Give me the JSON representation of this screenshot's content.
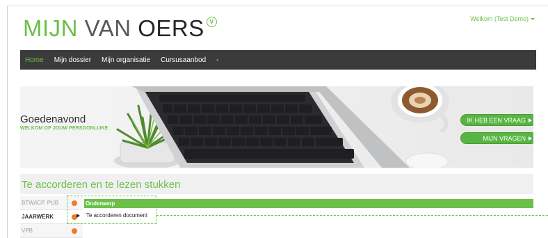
{
  "header": {
    "logo": {
      "part1": "MIJN ",
      "part2": "VAN ",
      "part3": "OERS",
      "mark": "V"
    },
    "welcome": "Welkom (Test Demo)"
  },
  "nav": {
    "items": [
      {
        "label": "Home",
        "active": true
      },
      {
        "label": "Mijn dossier",
        "active": false
      },
      {
        "label": "Mijn organisatie",
        "active": false
      },
      {
        "label": "Cursusaanbod",
        "active": false
      },
      {
        "label": "-",
        "active": false
      }
    ]
  },
  "hero": {
    "greeting": "Goedenavond",
    "subtitle": "WELKOM OP JOUW PERSOONLIJKE",
    "buttons": [
      {
        "label": "IK HEB EEN VRAAG"
      },
      {
        "label": "MIJN VRAGEN"
      }
    ],
    "colors": {
      "accent": "#6cc04a",
      "button": "#59b543"
    }
  },
  "section": {
    "title": "Te accorderen en te lezen stukken",
    "tabs": [
      {
        "label": "BTW/ICP, PUB",
        "active": false
      },
      {
        "label": "JAARWERK",
        "active": true
      },
      {
        "label": "VPB",
        "active": false
      }
    ],
    "table": {
      "header": "Onderwerp",
      "rows": [
        "Te accorderen document"
      ]
    },
    "status_color": "#f07b2a"
  }
}
